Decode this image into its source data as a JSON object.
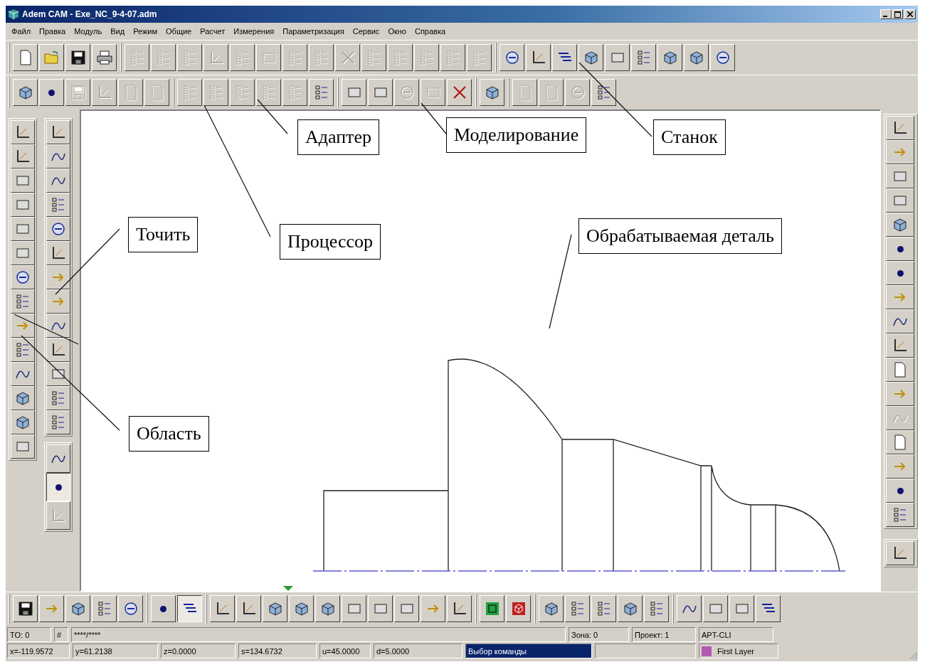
{
  "window": {
    "title": "Adem CAM - Exe_NC_9-4-07.adm"
  },
  "menu": [
    "Файл",
    "Правка",
    "Модуль",
    "Вид",
    "Режим",
    "Общие",
    "Расчет",
    "Измерения",
    "Параметризация",
    "Сервис",
    "Окно",
    "Справка"
  ],
  "toolbar_top": [
    [
      {
        "disabled": false
      },
      {
        "disabled": false
      },
      {
        "disabled": false
      },
      {
        "disabled": false
      }
    ],
    [
      {
        "disabled": true
      },
      {
        "disabled": true
      },
      {
        "disabled": true
      },
      {
        "disabled": true
      },
      {
        "disabled": true
      },
      {
        "disabled": true
      },
      {
        "disabled": true
      },
      {
        "disabled": true
      },
      {
        "disabled": true
      },
      {
        "disabled": true
      },
      {
        "disabled": true
      },
      {
        "disabled": true
      },
      {
        "disabled": true
      },
      {
        "disabled": true
      }
    ],
    [
      {
        "disabled": false
      },
      {
        "disabled": false
      },
      {
        "disabled": false
      },
      {
        "disabled": false
      },
      {
        "disabled": false
      },
      {
        "disabled": false
      },
      {
        "disabled": false
      },
      {
        "disabled": false
      },
      {
        "disabled": false
      }
    ]
  ],
  "toolbar_second": [
    [
      {
        "disabled": false
      },
      {
        "disabled": false
      },
      {
        "disabled": true
      },
      {
        "disabled": true
      },
      {
        "disabled": true
      },
      {
        "disabled": true
      }
    ],
    [
      {
        "disabled": true
      },
      {
        "disabled": true
      },
      {
        "disabled": true
      },
      {
        "disabled": true
      },
      {
        "disabled": true
      },
      {
        "disabled": false
      }
    ],
    [
      {
        "disabled": false
      },
      {
        "disabled": false
      },
      {
        "disabled": true
      },
      {
        "disabled": true
      },
      {
        "disabled": false
      }
    ],
    [
      {
        "disabled": false
      }
    ],
    [
      {
        "disabled": true
      },
      {
        "disabled": true
      },
      {
        "disabled": true
      },
      {
        "disabled": false
      }
    ]
  ],
  "left_toolbar_1": [
    {
      "disabled": false
    },
    {
      "disabled": false
    },
    {
      "disabled": false
    },
    {
      "disabled": false
    },
    {
      "disabled": false
    },
    {
      "disabled": false
    },
    {
      "disabled": false
    },
    {
      "disabled": false
    },
    {
      "disabled": false
    },
    {
      "disabled": false
    },
    {
      "disabled": false
    },
    {
      "disabled": false
    },
    {
      "disabled": false
    },
    {
      "disabled": false
    }
  ],
  "left_toolbar_2": {
    "tools": [
      {
        "disabled": false
      },
      {
        "disabled": false
      },
      {
        "disabled": false
      },
      {
        "disabled": false
      },
      {
        "disabled": false
      },
      {
        "disabled": false
      },
      {
        "disabled": false
      },
      {
        "disabled": false
      },
      {
        "disabled": false
      },
      {
        "disabled": false
      },
      {
        "disabled": false
      },
      {
        "disabled": false
      },
      {
        "disabled": false
      }
    ],
    "modes": [
      {
        "disabled": false,
        "pressed": false
      },
      {
        "disabled": false,
        "pressed": true
      },
      {
        "disabled": true,
        "pressed": false
      }
    ]
  },
  "right_toolbar": [
    [
      {
        "disabled": false
      },
      {
        "disabled": false
      },
      {
        "disabled": false
      },
      {
        "disabled": false
      },
      {
        "disabled": false
      },
      {
        "disabled": false
      },
      {
        "disabled": false
      },
      {
        "disabled": false
      },
      {
        "disabled": false
      },
      {
        "disabled": false
      },
      {
        "disabled": false
      },
      {
        "disabled": false
      },
      {
        "disabled": true
      },
      {
        "disabled": false
      },
      {
        "disabled": false
      },
      {
        "disabled": false
      },
      {
        "disabled": false
      }
    ],
    [
      {
        "disabled": false
      }
    ]
  ],
  "canvas": {
    "callouts": [
      {
        "text": "Адаптер"
      },
      {
        "text": "Моделирование"
      },
      {
        "text": "Станок"
      },
      {
        "text": "Точить"
      },
      {
        "text": "Процессор"
      },
      {
        "text": "Обрабатываемая деталь"
      },
      {
        "text": "Область"
      }
    ]
  },
  "bottom_toolbar": [
    [
      {
        "disabled": false
      },
      {
        "disabled": false
      },
      {
        "disabled": false
      },
      {
        "disabled": false
      },
      {
        "disabled": false
      }
    ],
    [
      {
        "disabled": false,
        "pressed": false
      },
      {
        "disabled": false,
        "pressed": true
      }
    ],
    [
      {
        "disabled": false
      },
      {
        "disabled": false
      },
      {
        "disabled": false
      },
      {
        "disabled": false
      },
      {
        "disabled": false
      },
      {
        "disabled": false
      },
      {
        "disabled": false
      },
      {
        "disabled": false
      },
      {
        "disabled": false
      },
      {
        "disabled": false
      }
    ],
    [
      {
        "disabled": false
      },
      {
        "disabled": false
      }
    ],
    [
      {
        "disabled": false
      },
      {
        "disabled": false
      },
      {
        "disabled": false
      },
      {
        "disabled": false
      },
      {
        "disabled": false
      }
    ],
    [
      {
        "disabled": false
      },
      {
        "disabled": false
      },
      {
        "disabled": false
      },
      {
        "disabled": false
      }
    ]
  ],
  "status_bar": {
    "row_1": [
      "TO: 0",
      "#",
      "****/****",
      "Зона: 0",
      "Проект: 1",
      "APT-CLI"
    ],
    "row_2": [
      "x=-119.9572",
      "y=61.2138",
      "z=0.0000",
      "s=134.6732",
      "u=45.0000",
      "d=5.0000",
      "Выбор команды"
    ],
    "layer": {
      "name": "First Layer",
      "color": "#b35ab3"
    }
  }
}
